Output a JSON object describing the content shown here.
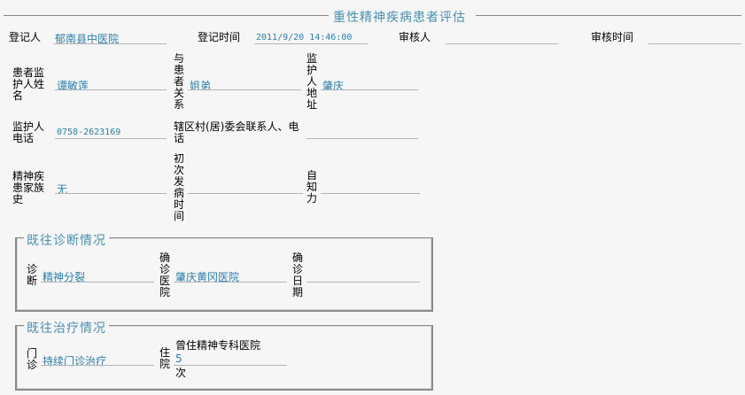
{
  "title": "重性精神疾病患者评估",
  "row1": {
    "register_person_label": "登记人",
    "register_person_value": "郁南县中医院",
    "register_time_label": "登记时间",
    "register_time_value": "2011/9/20 14:46:00",
    "reviewer_label": "审核人",
    "reviewer_value": "",
    "review_time_label": "审核时间",
    "review_time_value": ""
  },
  "row2": {
    "guardian_name_label": "患者监护人姓名",
    "guardian_name_value": "谭敏莲",
    "relation_label": "与患者关系",
    "relation_value": "姐弟",
    "guardian_address_label": "监护人地址",
    "guardian_address_value": "肇庆"
  },
  "row3": {
    "guardian_phone_label": "监护人电话",
    "guardian_phone_value": "0758-2623169",
    "village_contact_label": "辖区村(居)委会联系人、电话",
    "village_contact_value": ""
  },
  "row4": {
    "family_history_label": "精神疾患家族史",
    "family_history_value": "无",
    "first_onset_label": "初次发病时间",
    "first_onset_value": "",
    "insight_label": "自知力",
    "insight_value": ""
  },
  "diagnosis": {
    "legend": "既往诊断情况",
    "diag_label": "诊断",
    "diag_value": "精神分裂",
    "hospital_label": "确诊医院",
    "hospital_value": "肇庆黄冈医院",
    "date_label": "确诊日期",
    "date_value": ""
  },
  "treatment": {
    "legend": "既往治疗情况",
    "outpatient_label": "门诊",
    "outpatient_value": "持续门诊治疗",
    "inpatient_label": "住院",
    "inpatient_hospital": "曾住精神专科医院",
    "inpatient_count": "5",
    "inpatient_unit": "次"
  }
}
